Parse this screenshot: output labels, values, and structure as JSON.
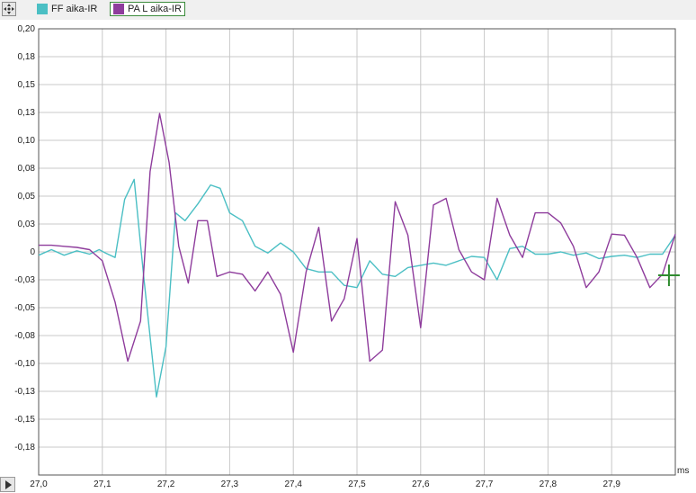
{
  "legend": {
    "move_icon": "move-arrows-icon",
    "items": [
      {
        "label": "FF aika-IR",
        "color": "#4bbfc4"
      },
      {
        "label": "PA L aika-IR",
        "color": "#8e3c9c"
      }
    ]
  },
  "scroll_icon": "play-right-icon",
  "chart_data": {
    "type": "line",
    "xlim": [
      27.0,
      28.0
    ],
    "ylim": [
      -0.2,
      0.2
    ],
    "x_ticks": [
      "27,0",
      "27,1",
      "27,2",
      "27,3",
      "27,4",
      "27,5",
      "27,6",
      "27,7",
      "27,8",
      "27,9"
    ],
    "x_tick_values": [
      27.0,
      27.1,
      27.2,
      27.3,
      27.4,
      27.5,
      27.6,
      27.7,
      27.8,
      27.9
    ],
    "x_unit": "ms",
    "y_ticks": [
      "0,20",
      "0,18",
      "0,15",
      "0,13",
      "0,10",
      "0,08",
      "0,05",
      "0,03",
      "0",
      "-0,03",
      "-0,05",
      "-0,08",
      "-0,10",
      "-0,13",
      "-0,15",
      "-0,18"
    ],
    "y_tick_values": [
      0.2,
      0.175,
      0.15,
      0.125,
      0.1,
      0.075,
      0.05,
      0.025,
      0,
      -0.025,
      -0.05,
      -0.075,
      -0.1,
      -0.125,
      -0.15,
      -0.175
    ],
    "grid": true,
    "cursor_marker": {
      "x": 27.99,
      "y": -0.021,
      "color": "#2e8b2e"
    },
    "series": [
      {
        "name": "FF aika-IR",
        "color": "#4bbfc4",
        "x": [
          27.0,
          27.02,
          27.04,
          27.06,
          27.08,
          27.095,
          27.105,
          27.12,
          27.135,
          27.15,
          27.165,
          27.185,
          27.2,
          27.215,
          27.23,
          27.25,
          27.27,
          27.285,
          27.3,
          27.32,
          27.34,
          27.36,
          27.38,
          27.4,
          27.42,
          27.44,
          27.46,
          27.48,
          27.5,
          27.52,
          27.54,
          27.56,
          27.58,
          27.6,
          27.62,
          27.64,
          27.66,
          27.68,
          27.7,
          27.72,
          27.74,
          27.76,
          27.78,
          27.8,
          27.82,
          27.84,
          27.86,
          27.88,
          27.9,
          27.92,
          27.94,
          27.96,
          27.98,
          28.0
        ],
        "y": [
          -0.003,
          0.002,
          -0.003,
          0.001,
          -0.002,
          0.002,
          -0.001,
          -0.005,
          0.047,
          0.065,
          -0.022,
          -0.13,
          -0.085,
          0.035,
          0.028,
          0.043,
          0.06,
          0.057,
          0.035,
          0.028,
          0.005,
          -0.001,
          0.008,
          0.0,
          -0.015,
          -0.018,
          -0.018,
          -0.03,
          -0.032,
          -0.008,
          -0.02,
          -0.022,
          -0.014,
          -0.012,
          -0.01,
          -0.012,
          -0.008,
          -0.004,
          -0.005,
          -0.025,
          0.003,
          0.005,
          -0.002,
          -0.002,
          0.0,
          -0.003,
          -0.001,
          -0.006,
          -0.004,
          -0.003,
          -0.005,
          -0.002,
          -0.002,
          0.015
        ]
      },
      {
        "name": "PA L aika-IR",
        "color": "#8e3c9c",
        "x": [
          27.0,
          27.02,
          27.04,
          27.06,
          27.08,
          27.1,
          27.12,
          27.14,
          27.16,
          27.175,
          27.19,
          27.205,
          27.22,
          27.235,
          27.25,
          27.265,
          27.28,
          27.3,
          27.32,
          27.34,
          27.36,
          27.38,
          27.4,
          27.42,
          27.44,
          27.46,
          27.48,
          27.5,
          27.52,
          27.54,
          27.56,
          27.58,
          27.6,
          27.62,
          27.64,
          27.66,
          27.68,
          27.7,
          27.72,
          27.74,
          27.76,
          27.78,
          27.8,
          27.82,
          27.84,
          27.86,
          27.88,
          27.9,
          27.92,
          27.94,
          27.96,
          27.98,
          28.0
        ],
        "y": [
          0.006,
          0.006,
          0.005,
          0.004,
          0.002,
          -0.008,
          -0.045,
          -0.098,
          -0.062,
          0.072,
          0.124,
          0.08,
          0.005,
          -0.028,
          0.028,
          0.028,
          -0.022,
          -0.018,
          -0.02,
          -0.035,
          -0.018,
          -0.038,
          -0.09,
          -0.018,
          0.022,
          -0.062,
          -0.042,
          0.012,
          -0.098,
          -0.088,
          0.045,
          0.015,
          -0.068,
          0.042,
          0.048,
          0.002,
          -0.018,
          -0.025,
          0.048,
          0.015,
          -0.005,
          0.035,
          0.035,
          0.026,
          0.005,
          -0.032,
          -0.018,
          0.016,
          0.015,
          -0.005,
          -0.032,
          -0.02,
          0.016
        ]
      }
    ]
  }
}
